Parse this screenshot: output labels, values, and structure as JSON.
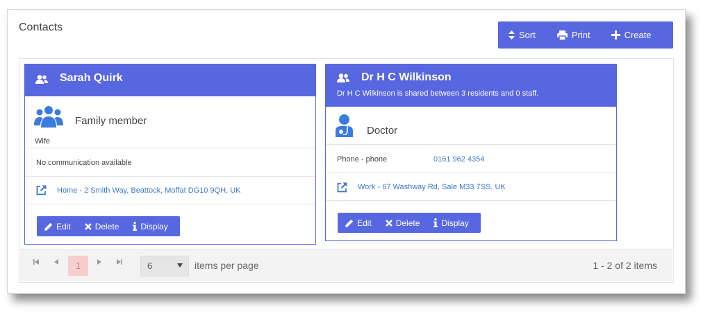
{
  "panel": {
    "title": "Contacts"
  },
  "toolbar": {
    "sort_label": "Sort",
    "print_label": "Print",
    "create_label": "Create"
  },
  "cards": [
    {
      "name": "Sarah Quirk",
      "type": "Family member",
      "relationship": "Wife",
      "communication": "No communication available",
      "address": "Home - 2 Smith Way, Beattock, Moffat DG10 9QH, UK",
      "actions": {
        "edit": "Edit",
        "delete": "Delete",
        "display": "Display"
      }
    },
    {
      "name": "Dr H C Wilkinson",
      "shared_note": "Dr H C Wilkinson is shared between 3 residents and 0 staff.",
      "type": "Doctor",
      "phone_label": "Phone - phone",
      "phone_value": "0161 962 4354",
      "address": "Work - 67 Washway Rd, Sale M33 7SS, UK",
      "actions": {
        "edit": "Edit",
        "delete": "Delete",
        "display": "Display"
      }
    }
  ],
  "pager": {
    "current_page": "1",
    "page_size": "6",
    "items_per_page_label": "items per page",
    "info": "1 - 2 of 2 items"
  },
  "colors": {
    "accent": "#5667e0",
    "link": "#3d76c9",
    "pager_active_bg": "#f5cfcf",
    "pager_active_text": "#e07b7b"
  }
}
